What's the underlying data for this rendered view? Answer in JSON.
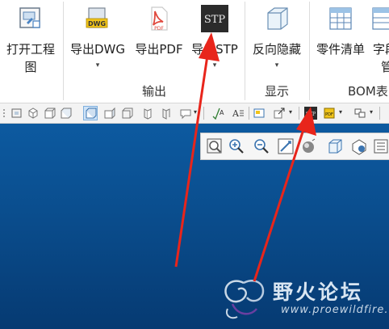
{
  "ribbon": {
    "buttons": [
      {
        "label_line1": "打开工程",
        "label_line2": "图",
        "icon": "open-drawing-icon"
      },
      {
        "label": "导出DWG",
        "icon": "dwg-file-icon",
        "has_dropdown": true
      },
      {
        "label": "导出PDF",
        "icon": "pdf-file-icon",
        "icon_text": "PDF"
      },
      {
        "label": "导出STP",
        "icon": "stp-file-icon",
        "icon_text": "STP",
        "has_dropdown": true
      },
      {
        "label": "反向隐藏",
        "icon": "reverse-hide-icon",
        "has_dropdown": true
      },
      {
        "label": "零件清单",
        "icon": "parts-list-icon"
      },
      {
        "label_line1": "字段",
        "label_line2": "管",
        "icon": "field-manager-icon"
      }
    ],
    "groups": [
      "输出",
      "显示",
      "BOM表"
    ],
    "dwg_icon_text": "DWG",
    "dropdown_glyph": "▾"
  },
  "toolbar": {
    "icons": [
      "view-icon",
      "cube-iso-icon",
      "cube-front-icon",
      "cube-top-icon",
      "cube-shaded-icon",
      "cube-wire-icon",
      "cube-right-icon",
      "cube-left-icon",
      "cube-back-icon",
      "cube-bottom-icon",
      "note-icon",
      "dimension-icon",
      "text-icon",
      "layout-icon",
      "export-icon",
      "stp-icon",
      "pdf-icon",
      "split-icon"
    ],
    "stp_text": "STP",
    "pdf_text": "PDF",
    "text_icon_text": "A",
    "dim_icon_text": "A"
  },
  "viewbar": {
    "icons": [
      "zoom-window-icon",
      "zoom-in-icon",
      "zoom-out-icon",
      "fit-view-icon",
      "render-icon",
      "shaded-view-icon",
      "display-style-icon",
      "section-view-icon"
    ]
  },
  "watermark": {
    "title": "野火论坛",
    "url": "www.proewildfire.cn"
  },
  "colors": {
    "canvas_top": "#0d5aa0",
    "canvas_bottom": "#063a72",
    "annotation_arrow": "#e8251b",
    "pdf_red": "#e0483d",
    "stp_dark": "#2b2b2b"
  }
}
